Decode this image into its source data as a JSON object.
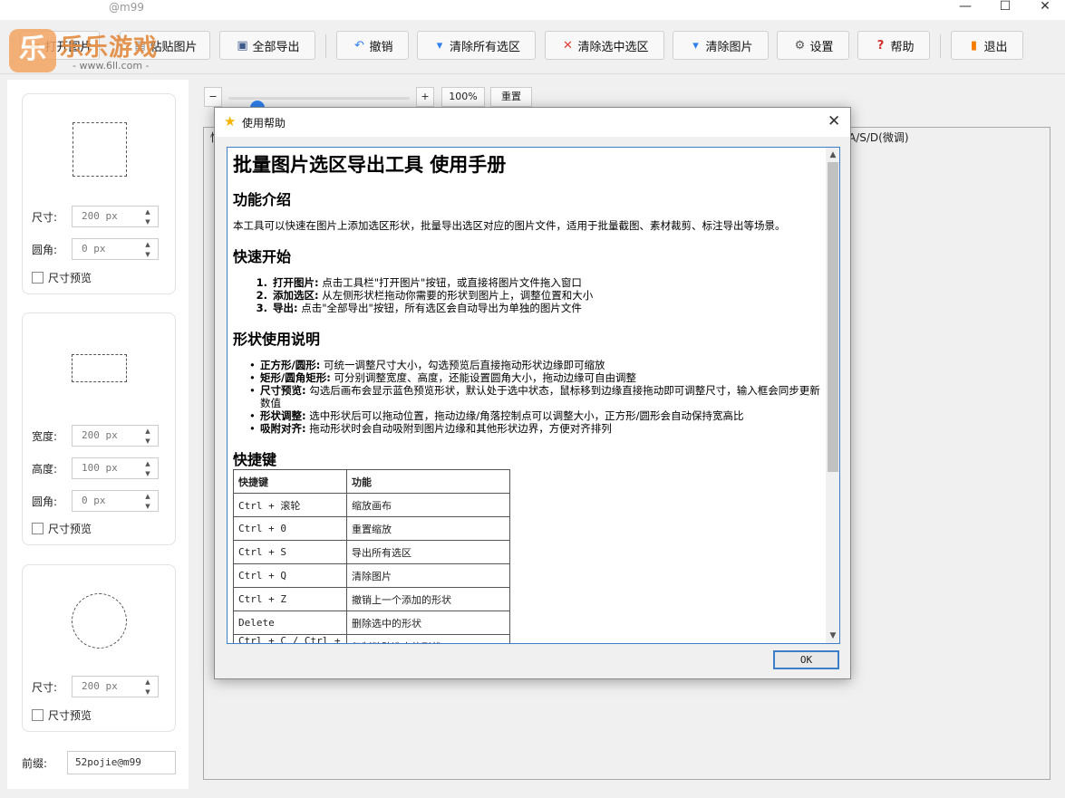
{
  "window": {
    "title": "@m99",
    "minimize_glyph": "—",
    "maximize_glyph": "☐",
    "close_glyph": "✕"
  },
  "watermark": {
    "logo": "乐",
    "name": "乐乐游戏",
    "url": "- www.6ll.com -"
  },
  "toolbar": {
    "open_label": "打开图片",
    "paste_label": "粘贴图片",
    "export_all_label": "全部导出",
    "undo_label": "撤销",
    "clear_all_label": "清除所有选区",
    "clear_selected_label": "清除选中选区",
    "clear_image_label": "清除图片",
    "settings_label": "设置",
    "help_label": "帮助",
    "exit_label": "退出"
  },
  "left_panel": {
    "square": {
      "size_label": "尺寸:",
      "size_value": "200 px",
      "radius_label": "圆角:",
      "radius_value": "0 px",
      "preview_label": "尺寸预览"
    },
    "rect": {
      "width_label": "宽度:",
      "width_value": "200 px",
      "height_label": "高度:",
      "height_value": "100 px",
      "radius_label": "圆角:",
      "radius_value": "0 px",
      "preview_label": "尺寸预览"
    },
    "circle": {
      "size_label": "尺寸:",
      "size_value": "200 px",
      "preview_label": "尺寸预览"
    },
    "prefix_label": "前缀:",
    "prefix_value": "52pojie@m99"
  },
  "zoom": {
    "minus": "−",
    "plus": "+",
    "level": "100%",
    "reset": "重置",
    "slider_fraction": 0.12
  },
  "canvas": {
    "hint_left": "快",
    "hint_right": "A/S/D(微调)"
  },
  "dialog": {
    "title": "使用帮助",
    "close": "✕",
    "ok": "OK",
    "heading": "批量图片选区导出工具 使用手册",
    "sec_intro": "功能介绍",
    "intro_text": "本工具可以快速在图片上添加选区形状，批量导出选区对应的图片文件，适用于批量截图、素材裁剪、标注导出等场景。",
    "sec_quick": "快速开始",
    "steps": [
      {
        "num": "1.",
        "bold": "打开图片:",
        "text": " 点击工具栏\"打开图片\"按钮，或直接将图片文件拖入窗口"
      },
      {
        "num": "2.",
        "bold": "添加选区:",
        "text": " 从左侧形状栏拖动你需要的形状到图片上，调整位置和大小"
      },
      {
        "num": "3.",
        "bold": "导出:",
        "text": " 点击\"全部导出\"按钮，所有选区会自动导出为单独的图片文件"
      }
    ],
    "sec_shapes": "形状使用说明",
    "bullets": [
      {
        "bold": "正方形/圆形:",
        "text": " 可统一调整尺寸大小，勾选预览后直接拖动形状边缘即可缩放"
      },
      {
        "bold": "矩形/圆角矩形:",
        "text": " 可分别调整宽度、高度，还能设置圆角大小，拖动边缘可自由调整"
      },
      {
        "bold": "尺寸预览:",
        "text": " 勾选后画布会显示蓝色预览形状，默认处于选中状态，鼠标移到边缘直接拖动即可调整尺寸，输入框会同步更新数值"
      },
      {
        "bold": "形状调整:",
        "text": " 选中形状后可以拖动位置，拖动边缘/角落控制点可以调整大小，正方形/圆形会自动保持宽高比"
      },
      {
        "bold": "吸附对齐:",
        "text": " 拖动形状时会自动吸附到图片边缘和其他形状边界，方便对齐排列"
      }
    ],
    "sec_keys": "快捷键",
    "table_headers": [
      "快捷键",
      "功能"
    ],
    "shortcuts": [
      [
        "Ctrl + 滚轮",
        "缩放画布"
      ],
      [
        "Ctrl + 0",
        "重置缩放"
      ],
      [
        "Ctrl + S",
        "导出所有选区"
      ],
      [
        "Ctrl + Q",
        "清除图片"
      ],
      [
        "Ctrl + Z",
        "撤销上一个添加的形状"
      ],
      [
        "Delete",
        "删除选中的形状"
      ],
      [
        "Ctrl + C / Ctrl + V",
        "复制粘贴选中的形状"
      ]
    ]
  },
  "colors": {
    "accent": "#2f80ed",
    "dialog_border": "#3c7fc8",
    "clear_all_icon": "#2f80ed",
    "clear_selected_icon": "#e53935",
    "help_icon": "#d32f2f",
    "exit_icon": "#f57c00",
    "star": "#f5b400"
  }
}
